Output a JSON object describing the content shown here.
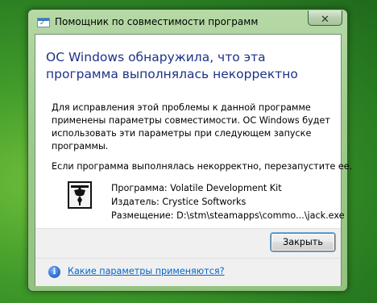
{
  "window": {
    "title": "Помощник по совместимости программ",
    "close_symbol": "✕"
  },
  "content": {
    "heading": "ОС Windows обнаружила, что эта программа выполнялась некорректно",
    "paragraph1": "Для исправления этой проблемы к данной программе применены параметры совместимости. ОС Windows будет использовать эти параметры при следующем запуске программы.",
    "paragraph2": "Если программа выполнялась некорректно, перезапустите ее."
  },
  "program": {
    "icon": "program-icon",
    "name_line": "Программа: Volatile Development Kit",
    "publisher_line": "Издатель: Crystice Softworks",
    "location_line": "Размещение: D:\\stm\\steamapps\\commo...\\jack.exe"
  },
  "buttons": {
    "close_label": "Закрыть"
  },
  "footer": {
    "info_icon": "info-icon",
    "info_glyph": "i",
    "link_text": "Какие параметры применяются?"
  },
  "colors": {
    "heading": "#1e3287",
    "link": "#0066cc",
    "frame": "#9fcb8c",
    "desktop": "#3f9a2a"
  }
}
